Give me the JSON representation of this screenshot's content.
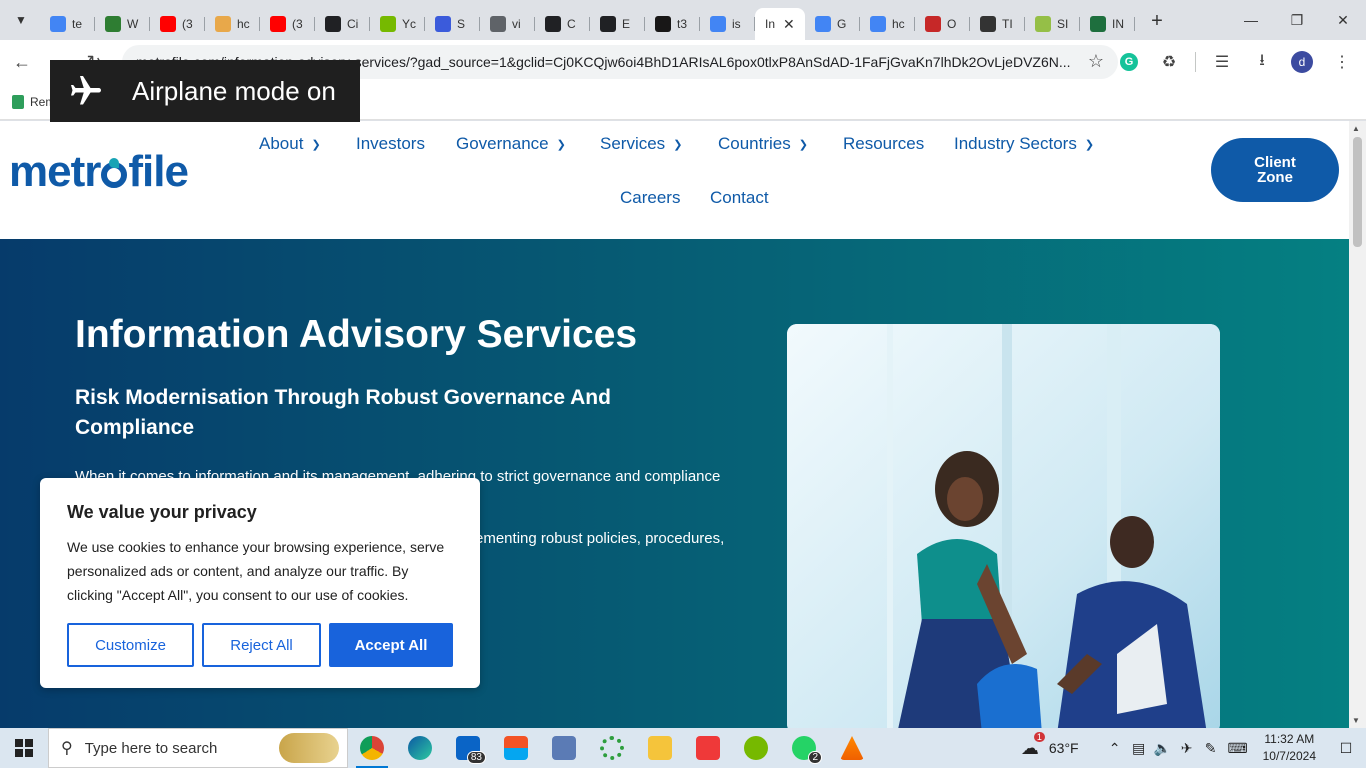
{
  "browser": {
    "tabs": [
      {
        "label": "te",
        "color": "#4285f4"
      },
      {
        "label": "W",
        "color": "#2e7d32"
      },
      {
        "label": "(3",
        "color": "#ff0000"
      },
      {
        "label": "hc",
        "color": "#e8a84a"
      },
      {
        "label": "(3",
        "color": "#ff0000"
      },
      {
        "label": "Ci",
        "color": "#202124"
      },
      {
        "label": "Yc",
        "color": "#76b900"
      },
      {
        "label": "S",
        "color": "#3b5bdb"
      },
      {
        "label": "vi",
        "color": "#5f6368"
      },
      {
        "label": "C",
        "color": "#202124"
      },
      {
        "label": "E",
        "color": "#202124"
      },
      {
        "label": "t3",
        "color": "#181717"
      },
      {
        "label": "is",
        "color": "#4285f4"
      },
      {
        "label": "In",
        "color": "#ffffff",
        "active": true
      },
      {
        "label": "G",
        "color": "#4285f4"
      },
      {
        "label": "hc",
        "color": "#4285f4"
      },
      {
        "label": "O",
        "color": "#c62828"
      },
      {
        "label": "TI",
        "color": "#333333"
      },
      {
        "label": "SI",
        "color": "#95bf47"
      },
      {
        "label": "IN",
        "color": "#1e6f3e"
      }
    ],
    "url": "metrofile.com/information-advisory-services/?gad_source=1&gclid=Cj0KCQjw6oi4BhD1ARIsAL6pox0tlxP8AnSdAD-1FaFjGvaKn7lhDk2OvLjeDVZ6N...",
    "profile_initial": "d",
    "bookmark_label": "Rem"
  },
  "toast": {
    "text": "Airplane mode on"
  },
  "site": {
    "nav": {
      "about": "About",
      "investors": "Investors",
      "governance": "Governance",
      "services": "Services",
      "countries": "Countries",
      "resources": "Resources",
      "industry": "Industry Sectors",
      "careers": "Careers",
      "contact": "Contact"
    },
    "client_zone": "Client Zone",
    "hero": {
      "title": "Information Advisory Services",
      "subtitle": "Risk Modernisation Through Robust Governance And Compliance",
      "body_line1": "When it comes to information and its management, adhering to strict governance and compliance",
      "body_line2": "ementing robust policies, procedures,"
    }
  },
  "cookie": {
    "title": "We value your privacy",
    "body": "We use cookies to enhance your browsing experience, serve personalized ads or content, and analyze our traffic. By clicking \"Accept All\", you consent to our use of cookies.",
    "customize": "Customize",
    "reject": "Reject All",
    "accept": "Accept All"
  },
  "taskbar": {
    "search_placeholder": "Type here to search",
    "mail_badge": "83",
    "whatsapp_badge": "2",
    "weather": "63°F",
    "weather_badge": "1",
    "time": "11:32 AM",
    "date": "10/7/2024"
  },
  "colors": {
    "brand": "#0f5aa8",
    "accent_button": "#1863dc"
  }
}
